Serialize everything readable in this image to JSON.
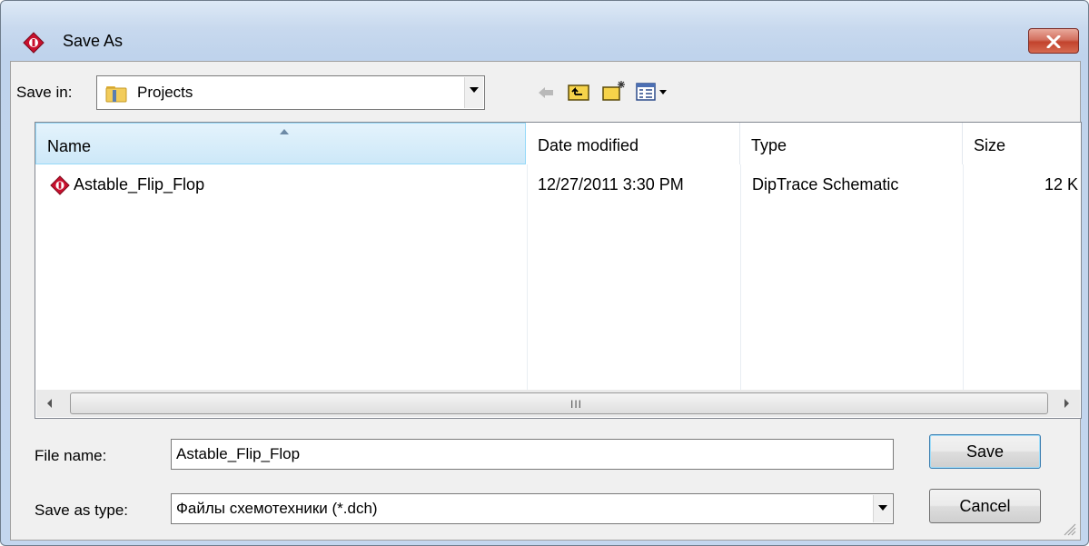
{
  "window": {
    "title": "Save As"
  },
  "toolbar": {
    "save_in_label": "Save in:",
    "save_in_value": "Projects"
  },
  "columns": {
    "name": "Name",
    "date": "Date modified",
    "type": "Type",
    "size": "Size"
  },
  "files": [
    {
      "name": "Astable_Flip_Flop",
      "date": "12/27/2011 3:30 PM",
      "type": "DipTrace Schematic",
      "size": "12 K"
    }
  ],
  "scrollbar": {
    "grip": "III"
  },
  "form": {
    "filename_label": "File name:",
    "filename_value": "Astable_Flip_Flop",
    "filetype_label": "Save as type:",
    "filetype_value": "Файлы схемотехники (*.dch)"
  },
  "buttons": {
    "save": "Save",
    "cancel": "Cancel"
  },
  "colors": {
    "close_button": "#c2432d",
    "header_highlight": "#cde8f8",
    "app_icon": "#c8102e"
  }
}
